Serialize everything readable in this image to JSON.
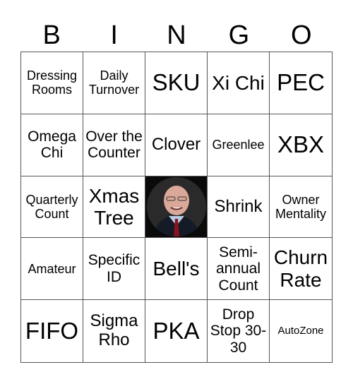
{
  "header": {
    "letters": [
      "B",
      "I",
      "N",
      "G",
      "O"
    ]
  },
  "cells": [
    {
      "text": "Dressing Rooms",
      "size": "s17"
    },
    {
      "text": "Daily Turnover",
      "size": "s17"
    },
    {
      "text": "SKU",
      "size": "s33"
    },
    {
      "text": "Xi Chi",
      "size": "s28"
    },
    {
      "text": "PEC",
      "size": "s33"
    },
    {
      "text": "Omega Chi",
      "size": "s21"
    },
    {
      "text": "Over the Counter",
      "size": "s21"
    },
    {
      "text": "Clover",
      "size": "s24"
    },
    {
      "text": "Greenlee",
      "size": "s17"
    },
    {
      "text": "XBX",
      "size": "s33"
    },
    {
      "text": "Quarterly Count",
      "size": "s17"
    },
    {
      "text": "Xmas Tree",
      "size": "s28"
    },
    {
      "text": "",
      "free": true,
      "image": "portrait-photo"
    },
    {
      "text": "Shrink",
      "size": "s24"
    },
    {
      "text": "Owner Mentality",
      "size": "s17"
    },
    {
      "text": "Amateur",
      "size": "s17"
    },
    {
      "text": "Specific ID",
      "size": "s21"
    },
    {
      "text": "Bell's",
      "size": "s28"
    },
    {
      "text": "Semi-annual Count",
      "size": "s21"
    },
    {
      "text": "Churn Rate",
      "size": "s28"
    },
    {
      "text": "FIFO",
      "size": "s33"
    },
    {
      "text": "Sigma Rho",
      "size": "s24"
    },
    {
      "text": "PKA",
      "size": "s33"
    },
    {
      "text": "Drop Stop 30-30",
      "size": "s21"
    },
    {
      "text": "AutoZone",
      "size": "s14"
    }
  ]
}
